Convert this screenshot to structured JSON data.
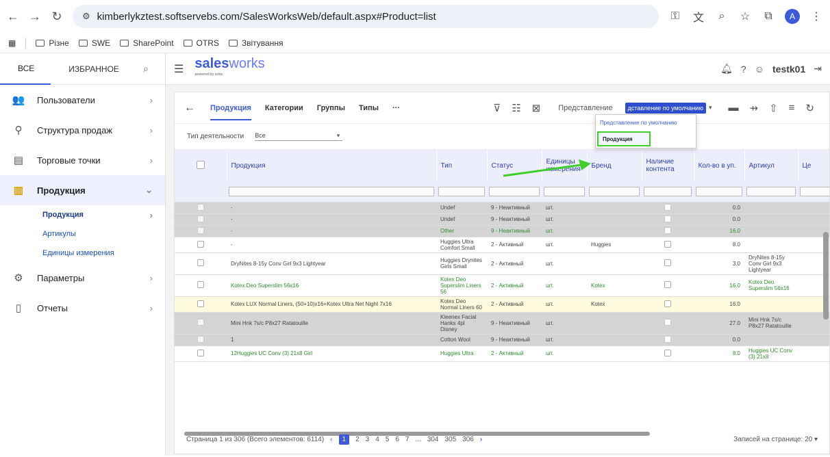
{
  "browser": {
    "url": "kimberlykztest.softservebs.com/SalesWorksWeb/default.aspx#Product=list",
    "bookmarks": [
      "Різне",
      "SWE",
      "SharePoint",
      "OTRS",
      "Звітування"
    ],
    "profile_letter": "A"
  },
  "sidebar": {
    "tab_all": "ВСЕ",
    "tab_favorites": "ИЗБРАННОЕ",
    "items": [
      {
        "label": "Пользователи",
        "icon": "users-icon"
      },
      {
        "label": "Структура продаж",
        "icon": "structure-icon"
      },
      {
        "label": "Торговые точки",
        "icon": "store-icon"
      },
      {
        "label": "Продукция",
        "icon": "products-icon"
      },
      {
        "label": "Параметры",
        "icon": "gear-icon"
      },
      {
        "label": "Отчеты",
        "icon": "report-icon"
      }
    ],
    "subitems": [
      "Продукция",
      "Артикулы",
      "Единицы измерения"
    ]
  },
  "topbar": {
    "logo_bold": "sales",
    "logo_light": "works",
    "logo_sub": "powered by sobs",
    "user": "testk01"
  },
  "toolbar": {
    "tabs": [
      "Продукция",
      "Категории",
      "Группы",
      "Типы",
      "···"
    ],
    "view_label": "Представление",
    "view_value": "дставление по умолчанию"
  },
  "filters": {
    "label": "Тип деятельности",
    "value": "Все"
  },
  "dropdown": {
    "options": [
      "Представление по умолчанию",
      "Продукция"
    ]
  },
  "table": {
    "headers": [
      "Продукция",
      "Тип",
      "Статус",
      "Единицы измерения",
      "Бренд",
      "Наличие контента",
      "Кол-во в уп.",
      "Артикул",
      "Це"
    ],
    "rows": [
      {
        "style": "gray",
        "name": "-",
        "type": "Undef",
        "status": "9 - Неактивный",
        "unit": "шт.",
        "brand": "",
        "qty": "0.0",
        "article": ""
      },
      {
        "style": "gray",
        "name": "-",
        "type": "Undef",
        "status": "9 - Неактивный",
        "unit": "шт.",
        "brand": "",
        "qty": "0.0",
        "article": ""
      },
      {
        "style": "gray green",
        "name": "-",
        "type": "Other",
        "status": "9 - Неактивный",
        "unit": "шт.",
        "brand": "",
        "qty": "16.0",
        "article": ""
      },
      {
        "style": "",
        "name": "-",
        "type": "Huggies Ultra Comfort Small",
        "status": "2 - Активный",
        "unit": "шт.",
        "brand": "Huggies",
        "qty": "8.0",
        "article": ""
      },
      {
        "style": "",
        "name": "DryNites 8-15y Conv Girl 9x3 Lightyear",
        "type": "Huggies Drynites Girls Small",
        "status": "2 - Активный",
        "unit": "шт.",
        "brand": "",
        "qty": "3.0",
        "article": "DryNites 8-15y Conv Girl 9x3 Lightyear"
      },
      {
        "style": "green",
        "name": "Kotex Deo Superslim 56x16",
        "type": "Kotex Deo Superslim Liners 56",
        "status": "2 - Активный",
        "unit": "шт.",
        "brand": "Kotex",
        "qty": "16.0",
        "article": "Kotex Deo Superslim 56x16"
      },
      {
        "style": "yellow",
        "name": "Kotex LUX Normal Liners, (50+10)x16+Kotex Ultra Net Night 7x16",
        "type": "Kotex Deo Normal Liners 60",
        "status": "2 - Активный",
        "unit": "шт.",
        "brand": "Kotex",
        "qty": "16.0",
        "article": ""
      },
      {
        "style": "gray",
        "name": "Mini Hnk 7s/c P8x27 Ratatouille",
        "type": "Kleenex Facial Hanks 4pl Disney",
        "status": "9 - Неактивный",
        "unit": "шт.",
        "brand": "",
        "qty": "27.0",
        "article": "Mini Hnk 7s/c P8x27 Ratatouille"
      },
      {
        "style": "gray",
        "name": "1",
        "type": "Cotton Wool",
        "status": "9 - Неактивный",
        "unit": "шт.",
        "brand": "",
        "qty": "0.0",
        "article": ""
      },
      {
        "style": "green",
        "name": "12Huggies UC Conv (3) 21x8 Girl",
        "type": "Huggies Ultra",
        "status": "2 - Активный",
        "unit": "шт.",
        "brand": "",
        "qty": "8.0",
        "article": "Huggies UC Conv (3) 21x8"
      }
    ]
  },
  "pager": {
    "summary": "Страница 1 из 306 (Всего элементов: 6114)",
    "pages": [
      "1",
      "2",
      "3",
      "4",
      "5",
      "6",
      "7",
      "...",
      "304",
      "305",
      "306"
    ],
    "per_page_label": "Записей на странице:",
    "per_page_value": "20"
  },
  "colors": {
    "accent": "#3b5bdb",
    "highlight": "#3ecf2a"
  }
}
